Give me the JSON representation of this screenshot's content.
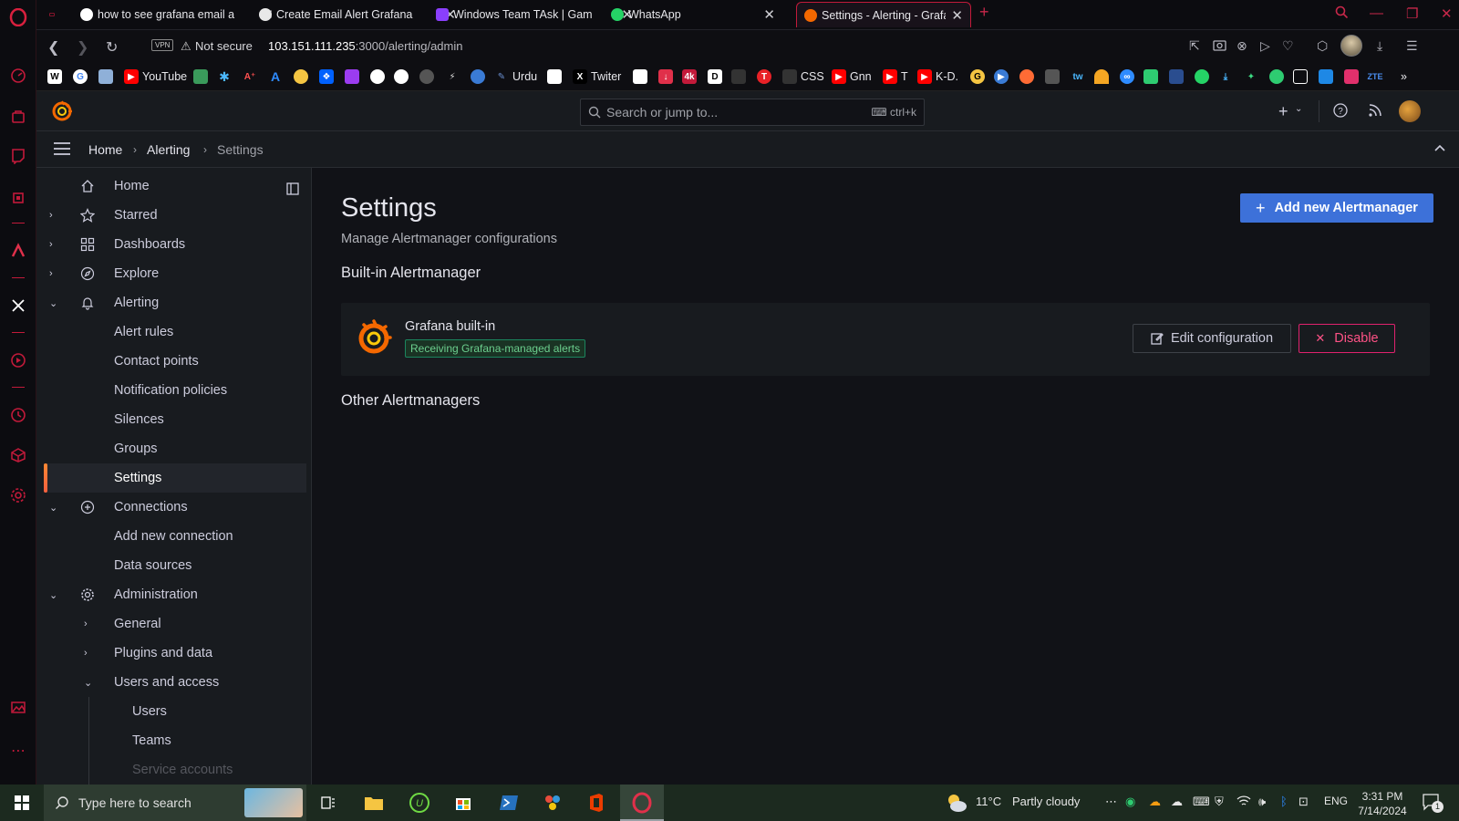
{
  "browser": {
    "tabs": [
      {
        "title": "how to see grafana email a",
        "favicon_color": "#ffffff",
        "active": false
      },
      {
        "title": "Create Email Alert Grafana",
        "favicon_color": "#ffffff",
        "active": false
      },
      {
        "title": "Windows Team TAsk | Gam",
        "favicon_color": "#8a3ffc",
        "active": false
      },
      {
        "title": "WhatsApp",
        "favicon_color": "#25d366",
        "active": false
      },
      {
        "title": "Settings - Alerting - Grafan",
        "favicon_color": "#f46800",
        "active": true
      }
    ],
    "address": {
      "vpn_label": "VPN",
      "security_label": "Not secure",
      "url_host": "103.151.111.235",
      "url_path": ":3000/alerting/admin"
    },
    "bookmarks": [
      {
        "label": "",
        "icon": "W",
        "color": "#ffffff"
      },
      {
        "label": "",
        "icon": "G",
        "color": "#ffffff"
      },
      {
        "label": "",
        "icon": "",
        "color": "#8fb0d8"
      },
      {
        "label": "YouTube",
        "icon": "▶",
        "color": "#ff0000"
      },
      {
        "label": "Urdu",
        "icon": "",
        "color": "#6a8fd0"
      },
      {
        "label": "Twiter",
        "icon": "X",
        "color": "#000000"
      },
      {
        "label": "CSS",
        "icon": "",
        "color": "#333"
      },
      {
        "label": "Gnn",
        "icon": "▶",
        "color": "#ff0000"
      },
      {
        "label": "T",
        "icon": "▶",
        "color": "#ff0000"
      },
      {
        "label": "K-D.",
        "icon": "▶",
        "color": "#ff0000"
      }
    ]
  },
  "grafana": {
    "search_placeholder": "Search or jump to...",
    "search_shortcut": "ctrl+k",
    "breadcrumbs": [
      "Home",
      "Alerting",
      "Settings"
    ],
    "nav": [
      {
        "label": "Home",
        "level": 0,
        "chevron": "",
        "icon": "home-icon"
      },
      {
        "label": "Starred",
        "level": 0,
        "chevron": "right",
        "icon": "star-icon"
      },
      {
        "label": "Dashboards",
        "level": 0,
        "chevron": "right",
        "icon": "dashboards-icon"
      },
      {
        "label": "Explore",
        "level": 0,
        "chevron": "right",
        "icon": "compass-icon"
      },
      {
        "label": "Alerting",
        "level": 0,
        "chevron": "down",
        "icon": "bell-icon"
      },
      {
        "label": "Alert rules",
        "level": 1
      },
      {
        "label": "Contact points",
        "level": 1
      },
      {
        "label": "Notification policies",
        "level": 1
      },
      {
        "label": "Silences",
        "level": 1
      },
      {
        "label": "Groups",
        "level": 1
      },
      {
        "label": "Settings",
        "level": 1,
        "active": true
      },
      {
        "label": "Connections",
        "level": 0,
        "chevron": "down",
        "icon": "connections-icon"
      },
      {
        "label": "Add new connection",
        "level": 1
      },
      {
        "label": "Data sources",
        "level": 1
      },
      {
        "label": "Administration",
        "level": 0,
        "chevron": "down",
        "icon": "gear-icon"
      },
      {
        "label": "General",
        "level": 1,
        "chevron": "right"
      },
      {
        "label": "Plugins and data",
        "level": 1,
        "chevron": "right"
      },
      {
        "label": "Users and access",
        "level": 1,
        "chevron": "down"
      },
      {
        "label": "Users",
        "level": 2
      },
      {
        "label": "Teams",
        "level": 2
      },
      {
        "label": "Service accounts",
        "level": 2
      }
    ],
    "page": {
      "title": "Settings",
      "subtitle": "Manage Alertmanager configurations",
      "add_button": "Add new Alertmanager",
      "builtin_heading": "Built-in Alertmanager",
      "builtin_card": {
        "name": "Grafana built-in",
        "badge": "Receiving Grafana-managed alerts",
        "edit_button": "Edit configuration",
        "disable_button": "Disable"
      },
      "other_heading": "Other Alertmanagers"
    }
  },
  "taskbar": {
    "search_placeholder": "Type here to search",
    "weather_temp": "11°C",
    "weather_text": "Partly cloudy",
    "lang": "ENG",
    "time": "3:31 PM",
    "date": "7/14/2024",
    "notification_count": "1"
  }
}
